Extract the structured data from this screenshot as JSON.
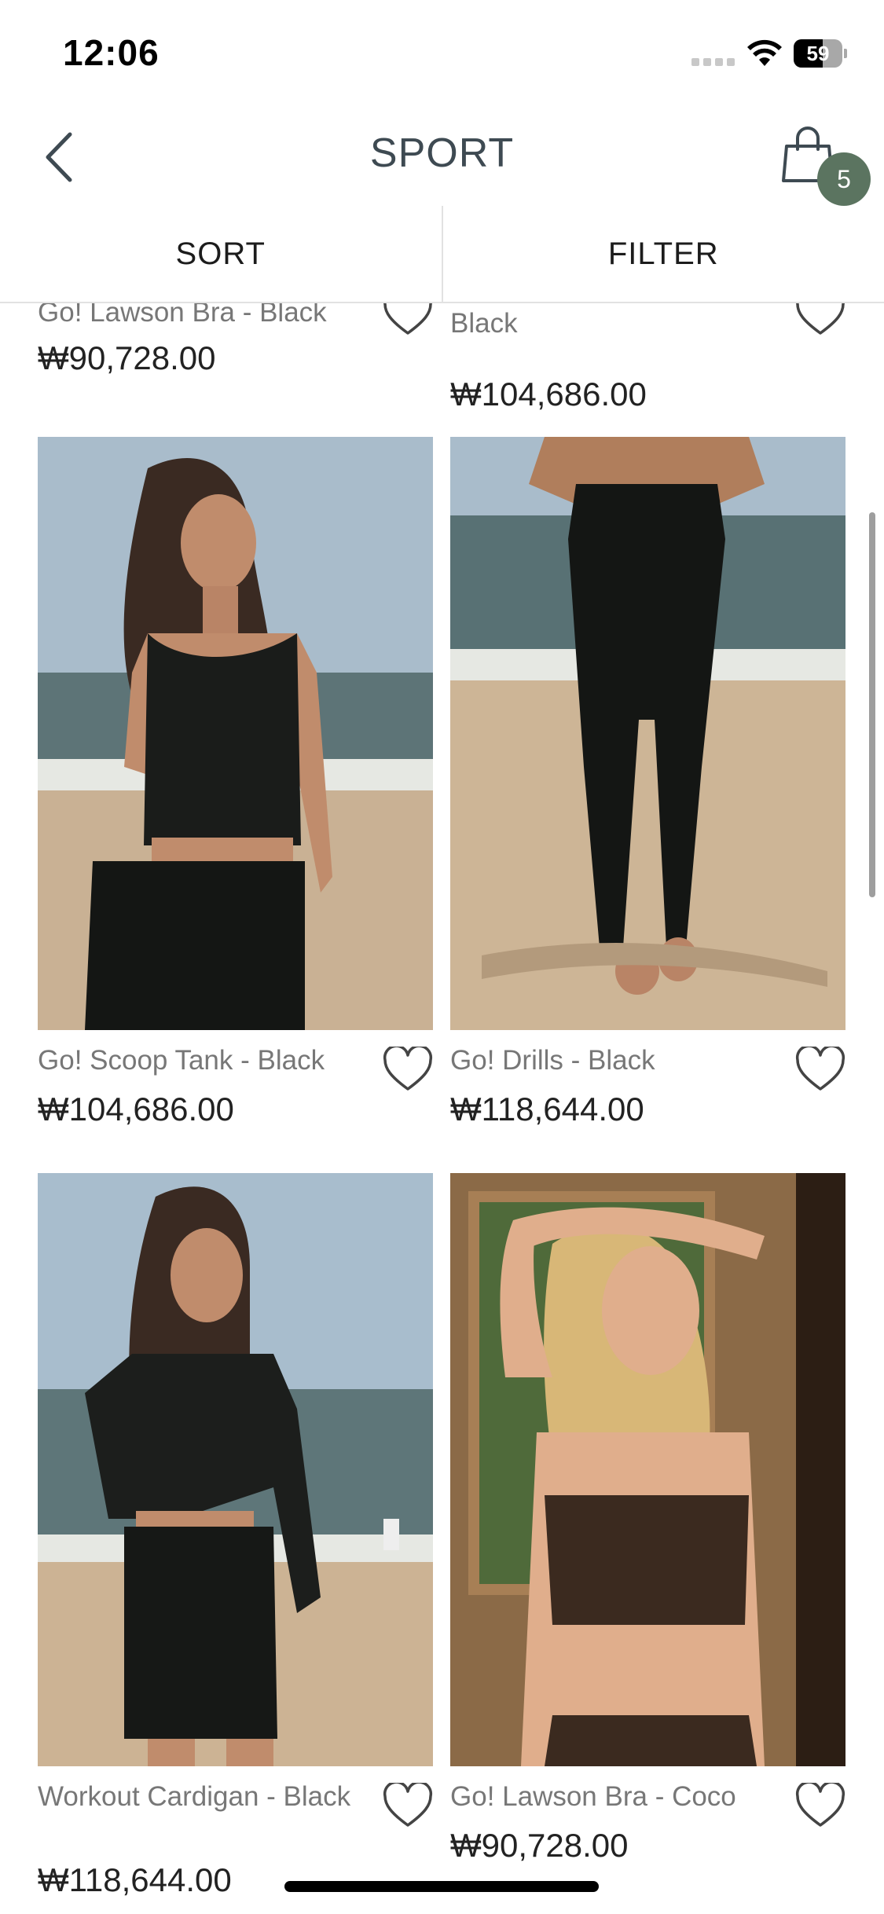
{
  "status": {
    "time": "12:06",
    "battery": "59",
    "battery_level": 0.59
  },
  "header": {
    "title": "SPORT",
    "cart_count": "5"
  },
  "toolbar": {
    "sort_label": "SORT",
    "filter_label": "FILTER"
  },
  "products": [
    {
      "name": "Go! Lawson Bra - Black",
      "price": "₩90,728.00"
    },
    {
      "name": "Go! Shortie Shorts - Black",
      "price": "₩104,686.00"
    },
    {
      "name": "Go! Scoop Tank - Black",
      "price": "₩104,686.00"
    },
    {
      "name": "Go! Drills - Black",
      "price": "₩118,644.00"
    },
    {
      "name": "Workout Cardigan - Black",
      "price": "₩118,644.00"
    },
    {
      "name": "Go! Lawson Bra - Coco",
      "price": "₩90,728.00"
    }
  ],
  "colors": {
    "accent": "#5b7460",
    "title": "#3e4a52",
    "name_text": "#777777"
  }
}
